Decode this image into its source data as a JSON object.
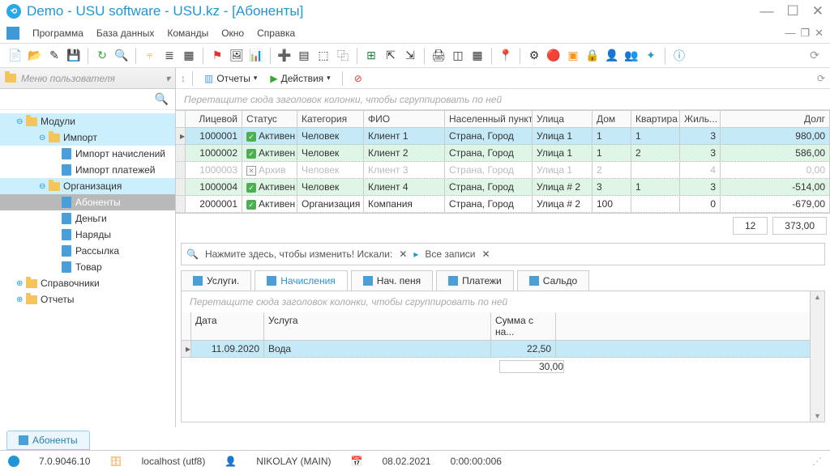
{
  "title": "Demo - USU software - USU.kz - [Абоненты]",
  "menu": {
    "items": [
      "Программа",
      "База данных",
      "Команды",
      "Окно",
      "Справка"
    ]
  },
  "left": {
    "header": "Меню пользователя",
    "tree": {
      "modules": "Модули",
      "import": "Импорт",
      "import_charges": "Импорт начислений",
      "import_payments": "Импорт платежей",
      "org": "Организация",
      "subscribers": "Абоненты",
      "money": "Деньги",
      "orders": "Наряды",
      "mailing": "Рассылка",
      "goods": "Товар",
      "refs": "Справочники",
      "reports": "Отчеты"
    }
  },
  "subtoolbar": {
    "reports": "Отчеты",
    "actions": "Действия"
  },
  "hints": {
    "group": "Перетащите сюда заголовок колонки, чтобы сгруппировать по ней"
  },
  "grid": {
    "headers": {
      "account": "Лицевой",
      "status": "Статус",
      "category": "Категория",
      "fio": "ФИО",
      "city": "Населенный пункт",
      "street": "Улица",
      "house": "Дом",
      "flat": "Квартира",
      "residents": "Жиль...",
      "debt": "Долг"
    },
    "rows": [
      {
        "account": "1000001",
        "status": "Активен",
        "status_ok": true,
        "category": "Человек",
        "fio": "Клиент 1",
        "city": "Страна, Город",
        "street": "Улица 1",
        "house": "1",
        "flat": "1",
        "residents": "3",
        "debt": "980,00",
        "sel": true
      },
      {
        "account": "1000002",
        "status": "Активен",
        "status_ok": true,
        "category": "Человек",
        "fio": "Клиент 2",
        "city": "Страна, Город",
        "street": "Улица 1",
        "house": "1",
        "flat": "2",
        "residents": "3",
        "debt": "586,00",
        "alt": true
      },
      {
        "account": "1000003",
        "status": "Архив",
        "status_ok": false,
        "category": "Человек",
        "fio": "Клиент 3",
        "city": "Страна, Город",
        "street": "Улица 1",
        "house": "2",
        "flat": "",
        "residents": "4",
        "debt": "0,00",
        "archived": true
      },
      {
        "account": "1000004",
        "status": "Активен",
        "status_ok": true,
        "category": "Человек",
        "fio": "Клиент 4",
        "city": "Страна, Город",
        "street": "Улица # 2",
        "house": "3",
        "flat": "1",
        "residents": "3",
        "debt": "-514,00",
        "alt": true
      },
      {
        "account": "2000001",
        "status": "Активен",
        "status_ok": true,
        "category": "Организация",
        "fio": "Компания",
        "city": "Страна, Город",
        "street": "Улица # 2",
        "house": "100",
        "flat": "",
        "residents": "0",
        "debt": "-679,00"
      }
    ],
    "footer": {
      "count": "12",
      "sum": "373,00"
    }
  },
  "searchbar": {
    "hint": "Нажмите здесь, чтобы изменить! Искали:",
    "all": "Все записи"
  },
  "detail": {
    "tabs": {
      "services": "Услуги.",
      "charges": "Начисления",
      "penalty": "Нач. пеня",
      "payments": "Платежи",
      "balance": "Сальдо"
    },
    "headers": {
      "date": "Дата",
      "service": "Услуга",
      "sum": "Сумма с на..."
    },
    "row": {
      "date": "11.09.2020",
      "service": "Вода",
      "sum": "22,50"
    },
    "footer_sum": "30,00"
  },
  "wintab": "Абоненты",
  "status": {
    "version": "7.0.9046.10",
    "host": "localhost (utf8)",
    "user": "NIKOLAY (MAIN)",
    "date": "08.02.2021",
    "time": "0:00:00:006"
  }
}
